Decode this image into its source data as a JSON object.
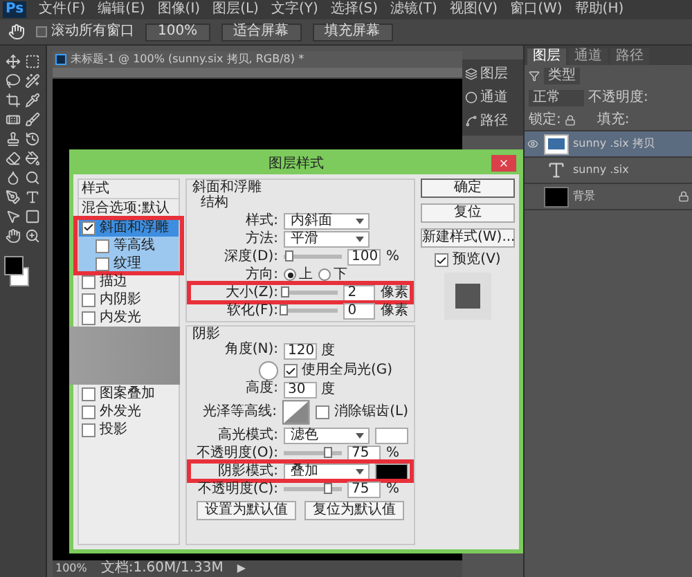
{
  "menu_bar": {
    "logo": "Ps",
    "items": [
      "文件(F)",
      "编辑(E)",
      "图像(I)",
      "图层(L)",
      "文字(Y)",
      "选择(S)",
      "滤镜(T)",
      "视图(V)",
      "窗口(W)",
      "帮助(H)"
    ]
  },
  "options_bar": {
    "scroll_all": {
      "label": "滚动所有窗口",
      "checked": false
    },
    "buttons": [
      "100%",
      "适合屏幕",
      "填充屏幕"
    ]
  },
  "document": {
    "tab_title": "未标题-1 @ 100% (sunny.six 拷贝, RGB/8) *",
    "zoom": "100%",
    "doc_size": "文档:1.60M/1.33M",
    "status_arrow": "▶"
  },
  "mini_panel": [
    {
      "label": "图层",
      "kind": "layers"
    },
    {
      "label": "通道",
      "kind": "channels"
    },
    {
      "label": "路径",
      "kind": "paths"
    }
  ],
  "layers_panel": {
    "tabs": [
      {
        "label": "图层",
        "selected": true
      },
      {
        "label": "通道",
        "selected": false
      },
      {
        "label": "路径",
        "selected": false
      }
    ],
    "filter": "类型",
    "blend_mode": "正常",
    "opacity_label": "不透明度:",
    "lock_label": "锁定:",
    "fill_label": "填充:",
    "layers": [
      {
        "name": "sunny .six 拷贝",
        "kind": "smart",
        "selected": true,
        "visible": true,
        "locked": false
      },
      {
        "name": "sunny .six",
        "kind": "text",
        "selected": false,
        "visible": false,
        "locked": false
      },
      {
        "name": "背景",
        "kind": "fill",
        "selected": false,
        "visible": false,
        "locked": true
      }
    ]
  },
  "dialog": {
    "title": "图层样式",
    "styles": [
      {
        "label": "样式",
        "kind": "header"
      },
      {
        "label": "混合选项:默认",
        "kind": "header"
      },
      {
        "label": "斜面和浮雕",
        "kind": "option",
        "checked": true,
        "selected": true,
        "annotated": true,
        "children": [
          {
            "label": "等高线",
            "checked": false
          },
          {
            "label": "纹理",
            "checked": false
          }
        ]
      },
      {
        "label": "描边",
        "kind": "option",
        "checked": false,
        "selected": false,
        "annotated": false
      },
      {
        "label": "内阴影",
        "kind": "option",
        "checked": false,
        "selected": false,
        "annotated": false
      },
      {
        "label": "内发光",
        "kind": "option",
        "checked": false,
        "selected": false,
        "annotated": false
      },
      {
        "kind": "cover"
      },
      {
        "label": "图案叠加",
        "kind": "option",
        "checked": false,
        "selected": false,
        "annotated": false
      },
      {
        "label": "外发光",
        "kind": "option",
        "checked": false,
        "selected": false,
        "annotated": false
      },
      {
        "label": "投影",
        "kind": "option",
        "checked": false,
        "selected": false,
        "annotated": false
      }
    ],
    "bevel": {
      "title": "斜面和浮雕",
      "subtitle": "结构",
      "rows": [
        {
          "kind": "select",
          "label": "样式:",
          "value": "内斜面",
          "annotated": false
        },
        {
          "kind": "select",
          "label": "方法:",
          "value": "平滑",
          "annotated": false
        },
        {
          "kind": "slider",
          "label": "深度(D):",
          "value": "100",
          "unit": "%",
          "level": 0.1,
          "annotated": false
        },
        {
          "kind": "radio",
          "label": "方向:",
          "options": [
            {
              "label": "上",
              "selected": true
            },
            {
              "label": "下",
              "selected": false
            }
          ],
          "annotated": false
        },
        {
          "kind": "slider",
          "label": "大小(Z):",
          "value": "2",
          "unit": "像素",
          "level": 0.02,
          "annotated": true
        },
        {
          "kind": "slider",
          "label": "软化(F):",
          "value": "0",
          "unit": "像素",
          "level": 0,
          "annotated": false
        }
      ]
    },
    "shading": {
      "title": "阴影",
      "angle": {
        "label": "角度(N):",
        "value": "120",
        "unit": "度"
      },
      "global_light": {
        "label": "使用全局光(G)",
        "checked": true
      },
      "altitude": {
        "label": "高度:",
        "value": "30",
        "unit": "度"
      },
      "gloss": {
        "label": "光泽等高线:",
        "anti_alias": {
          "label": "消除锯齿(L)",
          "checked": false
        }
      },
      "rows": [
        {
          "kind": "select",
          "label": "高光模式:",
          "value": "滤色",
          "color": "#ffffff",
          "annotated": false
        },
        {
          "kind": "slider",
          "label": "不透明度(O):",
          "value": "75",
          "unit": "%",
          "level": 0.75,
          "annotated": false
        },
        {
          "kind": "select",
          "label": "阴影模式:",
          "value": "叠加",
          "color": "#000000",
          "annotated": true
        },
        {
          "kind": "slider",
          "label": "不透明度(C):",
          "value": "75",
          "unit": "%",
          "level": 0.75,
          "annotated": false
        }
      ]
    },
    "footer_buttons": [
      "设置为默认值",
      "复位为默认值"
    ],
    "side_buttons": [
      "确定",
      "复位",
      "新建样式(W)..."
    ],
    "preview": {
      "label": "预览(V)",
      "checked": true
    }
  }
}
